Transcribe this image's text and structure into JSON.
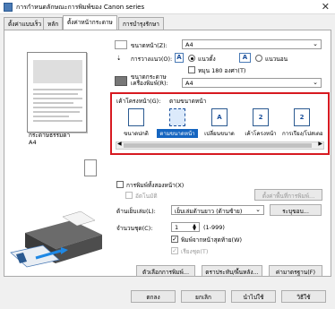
{
  "window": {
    "title": "การกำหนดลักษณะการพิมพ์ของ Canon                series",
    "close_glyph": "✕"
  },
  "tabs": [
    {
      "label": "ตั้งค่าแบบเร็ว"
    },
    {
      "label": "หลัก"
    },
    {
      "label": "ตั้งค่าหน้ากระดาษ"
    },
    {
      "label": "การบำรุงรักษา"
    }
  ],
  "preview": {
    "media_label": "กระดาษธรรมดา",
    "media_value": "A4"
  },
  "page_setup": {
    "page_size_label": "ขนาดหน้า(Z):",
    "page_size_value": "A4",
    "orientation_label": "การวางแนว(O):",
    "portrait_label": "แนวตั้ง",
    "landscape_label": "แนวนอน",
    "rotate_label": "หมุน 180 องศา(T)",
    "printer_paper_label": "ขนาดกระดาษเครื่องพิมพ์(R):",
    "printer_paper_value": "A4"
  },
  "page_layout": {
    "label": "เค้าโครงหน้า(G):",
    "current": "ตามขนาดหน้า",
    "items": [
      {
        "label": "ขนาดปกติ",
        "icon": ""
      },
      {
        "label": "ตามขนาดหน้า",
        "icon": ""
      },
      {
        "label": "เปลี่ยนขนาด",
        "icon": "A"
      },
      {
        "label": "เค้าโครงหน้า",
        "icon": "2"
      },
      {
        "label": "การเรียง/โปสเตอร์",
        "icon": "2"
      }
    ]
  },
  "options": {
    "auto_duplex_label": "การพิมพ์ทั้งสองหน้า(X)",
    "auto_label": "อัตโนมัติ",
    "print_area_button": "ตั้งค่าพื้นที่การพิมพ์...",
    "binding_label": "ด้านเย็บเล่ม(L):",
    "binding_value": "เย็บเล่มด้านยาว (ด้านซ้าย)",
    "margin_button": "ระบุขอบ...",
    "copies_label": "จำนวนชุด(C):",
    "copies_value": "1",
    "copies_range": "(1-999)",
    "last_page_label": "พิมพ์จากหน้าสุดท้าย(W)",
    "collate_label": "เรียงชุด(T)"
  },
  "footer_buttons": {
    "print_options": "ตัวเลือกการพิมพ์...",
    "stamp_background": "ตราประทับ/พื้นหลัง...",
    "defaults": "ค่ามาตรฐาน(F)"
  },
  "dialog_buttons": {
    "ok": "ตกลง",
    "cancel": "ยกเลิก",
    "apply": "นำไปใช้",
    "help": "วิธีใช้"
  },
  "colors": {
    "highlight_border": "#d71920",
    "selection": "#1565c0"
  }
}
